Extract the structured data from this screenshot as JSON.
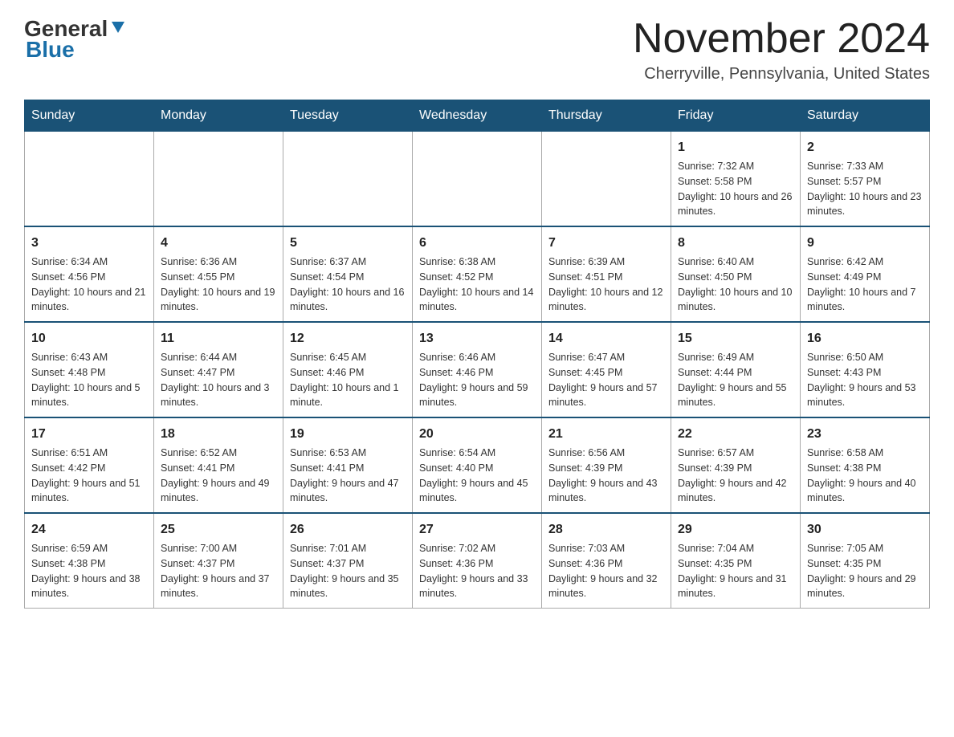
{
  "header": {
    "logo_general": "General",
    "logo_blue": "Blue",
    "month_title": "November 2024",
    "location": "Cherryville, Pennsylvania, United States"
  },
  "days_of_week": [
    "Sunday",
    "Monday",
    "Tuesday",
    "Wednesday",
    "Thursday",
    "Friday",
    "Saturday"
  ],
  "weeks": [
    [
      {
        "day": "",
        "sunrise": "",
        "sunset": "",
        "daylight": ""
      },
      {
        "day": "",
        "sunrise": "",
        "sunset": "",
        "daylight": ""
      },
      {
        "day": "",
        "sunrise": "",
        "sunset": "",
        "daylight": ""
      },
      {
        "day": "",
        "sunrise": "",
        "sunset": "",
        "daylight": ""
      },
      {
        "day": "",
        "sunrise": "",
        "sunset": "",
        "daylight": ""
      },
      {
        "day": "1",
        "sunrise": "Sunrise: 7:32 AM",
        "sunset": "Sunset: 5:58 PM",
        "daylight": "Daylight: 10 hours and 26 minutes."
      },
      {
        "day": "2",
        "sunrise": "Sunrise: 7:33 AM",
        "sunset": "Sunset: 5:57 PM",
        "daylight": "Daylight: 10 hours and 23 minutes."
      }
    ],
    [
      {
        "day": "3",
        "sunrise": "Sunrise: 6:34 AM",
        "sunset": "Sunset: 4:56 PM",
        "daylight": "Daylight: 10 hours and 21 minutes."
      },
      {
        "day": "4",
        "sunrise": "Sunrise: 6:36 AM",
        "sunset": "Sunset: 4:55 PM",
        "daylight": "Daylight: 10 hours and 19 minutes."
      },
      {
        "day": "5",
        "sunrise": "Sunrise: 6:37 AM",
        "sunset": "Sunset: 4:54 PM",
        "daylight": "Daylight: 10 hours and 16 minutes."
      },
      {
        "day": "6",
        "sunrise": "Sunrise: 6:38 AM",
        "sunset": "Sunset: 4:52 PM",
        "daylight": "Daylight: 10 hours and 14 minutes."
      },
      {
        "day": "7",
        "sunrise": "Sunrise: 6:39 AM",
        "sunset": "Sunset: 4:51 PM",
        "daylight": "Daylight: 10 hours and 12 minutes."
      },
      {
        "day": "8",
        "sunrise": "Sunrise: 6:40 AM",
        "sunset": "Sunset: 4:50 PM",
        "daylight": "Daylight: 10 hours and 10 minutes."
      },
      {
        "day": "9",
        "sunrise": "Sunrise: 6:42 AM",
        "sunset": "Sunset: 4:49 PM",
        "daylight": "Daylight: 10 hours and 7 minutes."
      }
    ],
    [
      {
        "day": "10",
        "sunrise": "Sunrise: 6:43 AM",
        "sunset": "Sunset: 4:48 PM",
        "daylight": "Daylight: 10 hours and 5 minutes."
      },
      {
        "day": "11",
        "sunrise": "Sunrise: 6:44 AM",
        "sunset": "Sunset: 4:47 PM",
        "daylight": "Daylight: 10 hours and 3 minutes."
      },
      {
        "day": "12",
        "sunrise": "Sunrise: 6:45 AM",
        "sunset": "Sunset: 4:46 PM",
        "daylight": "Daylight: 10 hours and 1 minute."
      },
      {
        "day": "13",
        "sunrise": "Sunrise: 6:46 AM",
        "sunset": "Sunset: 4:46 PM",
        "daylight": "Daylight: 9 hours and 59 minutes."
      },
      {
        "day": "14",
        "sunrise": "Sunrise: 6:47 AM",
        "sunset": "Sunset: 4:45 PM",
        "daylight": "Daylight: 9 hours and 57 minutes."
      },
      {
        "day": "15",
        "sunrise": "Sunrise: 6:49 AM",
        "sunset": "Sunset: 4:44 PM",
        "daylight": "Daylight: 9 hours and 55 minutes."
      },
      {
        "day": "16",
        "sunrise": "Sunrise: 6:50 AM",
        "sunset": "Sunset: 4:43 PM",
        "daylight": "Daylight: 9 hours and 53 minutes."
      }
    ],
    [
      {
        "day": "17",
        "sunrise": "Sunrise: 6:51 AM",
        "sunset": "Sunset: 4:42 PM",
        "daylight": "Daylight: 9 hours and 51 minutes."
      },
      {
        "day": "18",
        "sunrise": "Sunrise: 6:52 AM",
        "sunset": "Sunset: 4:41 PM",
        "daylight": "Daylight: 9 hours and 49 minutes."
      },
      {
        "day": "19",
        "sunrise": "Sunrise: 6:53 AM",
        "sunset": "Sunset: 4:41 PM",
        "daylight": "Daylight: 9 hours and 47 minutes."
      },
      {
        "day": "20",
        "sunrise": "Sunrise: 6:54 AM",
        "sunset": "Sunset: 4:40 PM",
        "daylight": "Daylight: 9 hours and 45 minutes."
      },
      {
        "day": "21",
        "sunrise": "Sunrise: 6:56 AM",
        "sunset": "Sunset: 4:39 PM",
        "daylight": "Daylight: 9 hours and 43 minutes."
      },
      {
        "day": "22",
        "sunrise": "Sunrise: 6:57 AM",
        "sunset": "Sunset: 4:39 PM",
        "daylight": "Daylight: 9 hours and 42 minutes."
      },
      {
        "day": "23",
        "sunrise": "Sunrise: 6:58 AM",
        "sunset": "Sunset: 4:38 PM",
        "daylight": "Daylight: 9 hours and 40 minutes."
      }
    ],
    [
      {
        "day": "24",
        "sunrise": "Sunrise: 6:59 AM",
        "sunset": "Sunset: 4:38 PM",
        "daylight": "Daylight: 9 hours and 38 minutes."
      },
      {
        "day": "25",
        "sunrise": "Sunrise: 7:00 AM",
        "sunset": "Sunset: 4:37 PM",
        "daylight": "Daylight: 9 hours and 37 minutes."
      },
      {
        "day": "26",
        "sunrise": "Sunrise: 7:01 AM",
        "sunset": "Sunset: 4:37 PM",
        "daylight": "Daylight: 9 hours and 35 minutes."
      },
      {
        "day": "27",
        "sunrise": "Sunrise: 7:02 AM",
        "sunset": "Sunset: 4:36 PM",
        "daylight": "Daylight: 9 hours and 33 minutes."
      },
      {
        "day": "28",
        "sunrise": "Sunrise: 7:03 AM",
        "sunset": "Sunset: 4:36 PM",
        "daylight": "Daylight: 9 hours and 32 minutes."
      },
      {
        "day": "29",
        "sunrise": "Sunrise: 7:04 AM",
        "sunset": "Sunset: 4:35 PM",
        "daylight": "Daylight: 9 hours and 31 minutes."
      },
      {
        "day": "30",
        "sunrise": "Sunrise: 7:05 AM",
        "sunset": "Sunset: 4:35 PM",
        "daylight": "Daylight: 9 hours and 29 minutes."
      }
    ]
  ]
}
